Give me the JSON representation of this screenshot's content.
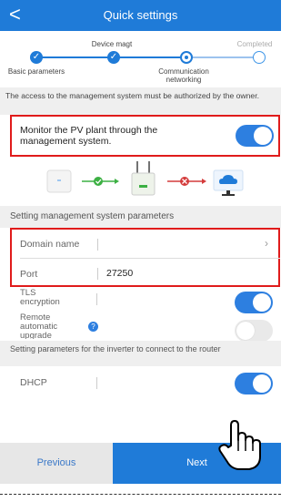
{
  "header": {
    "back_label": "<",
    "title": "Quick settings"
  },
  "steps": {
    "items": [
      {
        "label": "Basic parameters",
        "state": "done"
      },
      {
        "label": "Device magt",
        "state": "done"
      },
      {
        "label": "Communication networking",
        "state": "current"
      },
      {
        "label": "Completed",
        "state": "pending"
      }
    ]
  },
  "notice": "The access to the management system must be authorized by the owner.",
  "monitor": {
    "label": "Monitor the PV plant through the management system.",
    "enabled": true
  },
  "diagram": {
    "icons": [
      "inverter-icon",
      "dongle-icon",
      "router-icon",
      "cloud-server-icon"
    ]
  },
  "mgmt": {
    "section_title": "Setting management system parameters",
    "domain_label": "Domain name",
    "domain_value": "",
    "port_label": "Port",
    "port_value": "27250"
  },
  "tls": {
    "label": "TLS encryption",
    "enabled": true
  },
  "remote": {
    "label": "Remote automatic upgrade",
    "info_icon": "info-icon",
    "enabled": false
  },
  "router": {
    "section_title": "Setting parameters for the inverter to connect to the router",
    "dhcp_label": "DHCP",
    "dhcp_enabled": true
  },
  "footer": {
    "previous_label": "Previous",
    "next_label": "Next"
  },
  "colors": {
    "primary": "#1f7bd8",
    "highlight": "#e01b1b",
    "error": "#e01b1b",
    "ok": "#3cb043"
  }
}
